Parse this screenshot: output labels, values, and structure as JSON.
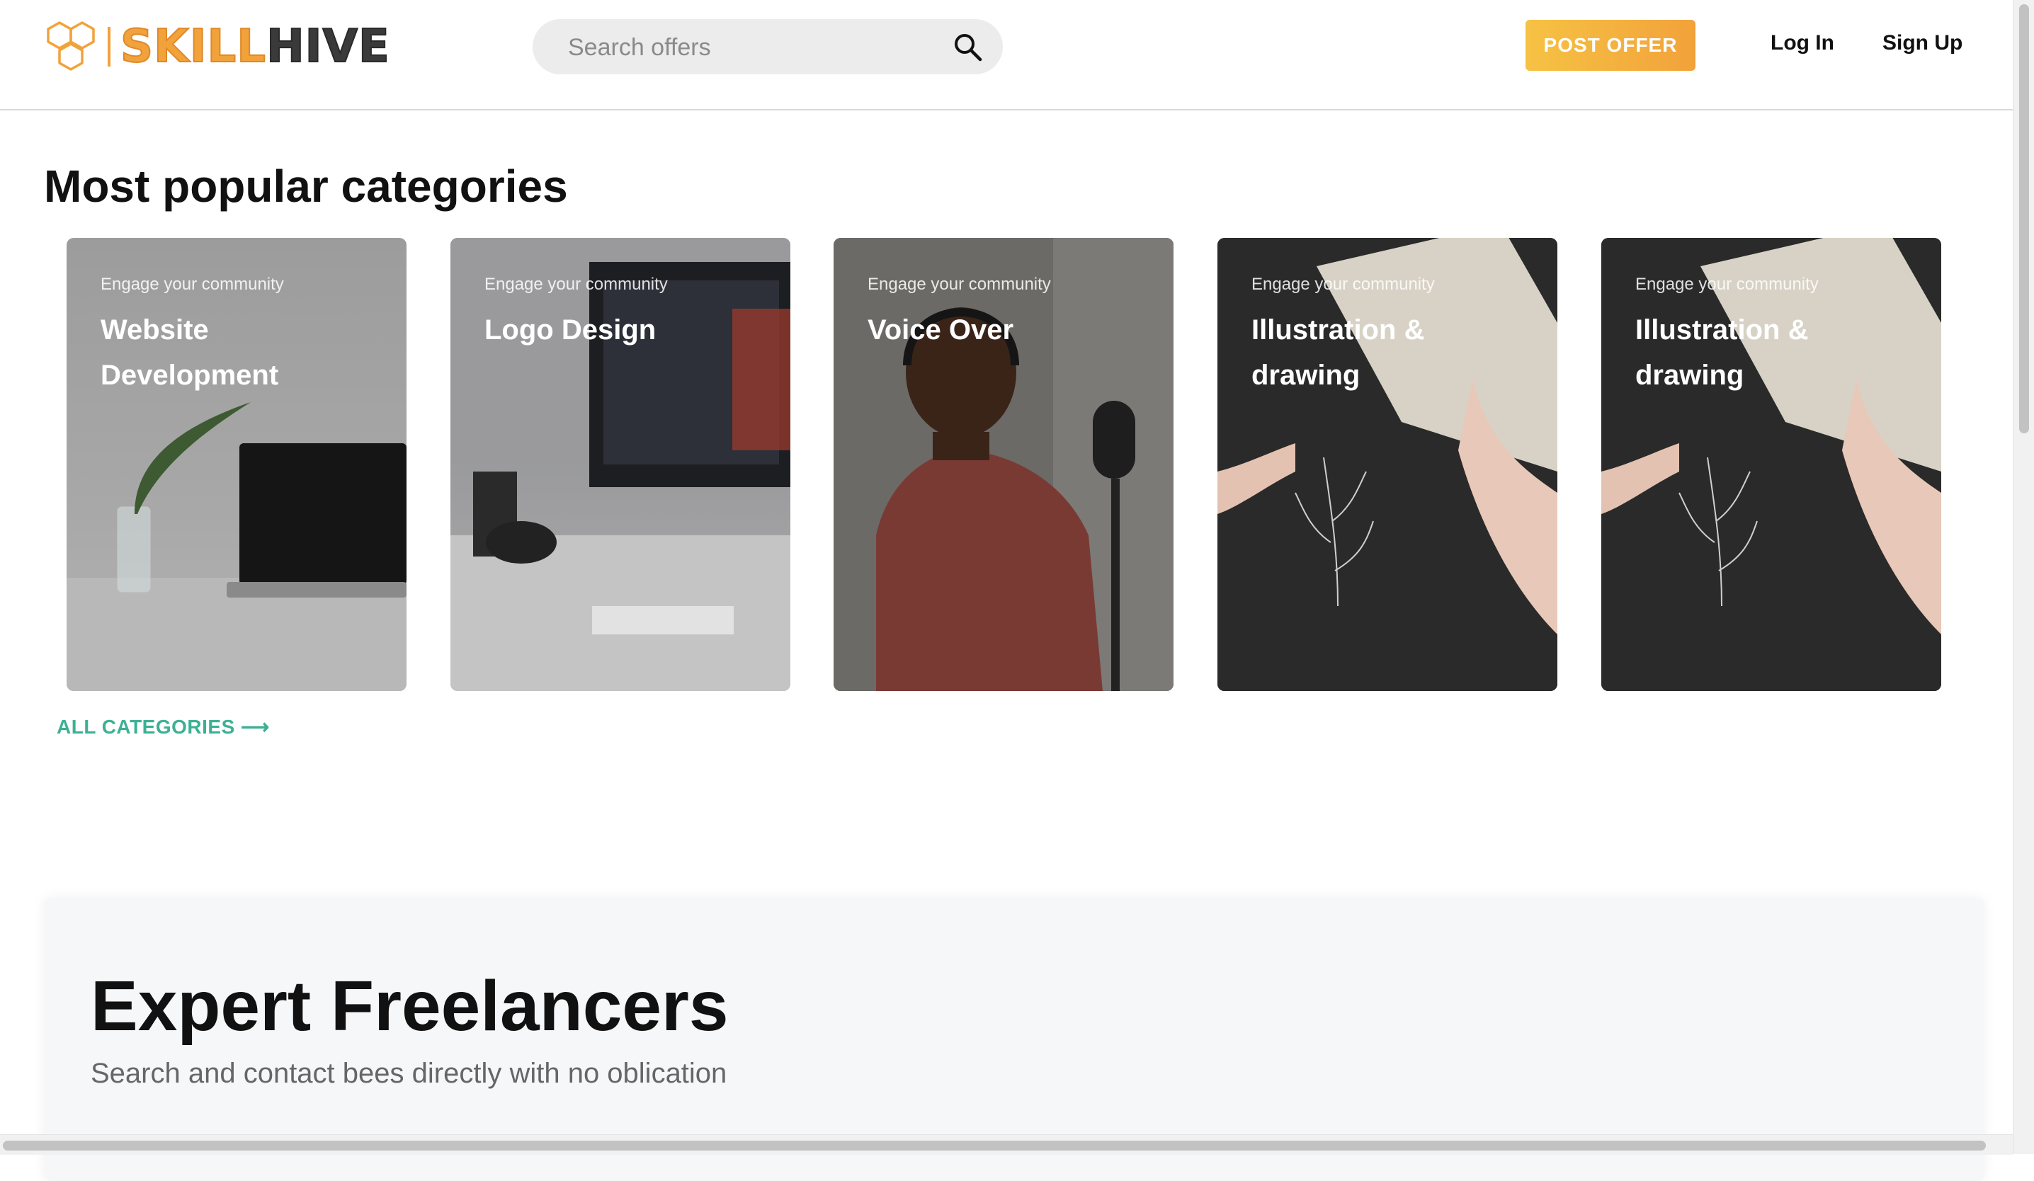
{
  "header": {
    "logo_text_1": "SKILL",
    "logo_text_2": "HIVE",
    "search_placeholder": "Search offers",
    "post_offer_label": "POST OFFER",
    "login_label": "Log In",
    "signup_label": "Sign Up"
  },
  "categories": {
    "title": "Most popular categories",
    "cards": [
      {
        "overline": "Engage your community",
        "title": "Website Development"
      },
      {
        "overline": "Engage your community",
        "title": "Logo Design"
      },
      {
        "overline": "Engage your community",
        "title": "Voice Over"
      },
      {
        "overline": "Engage your community",
        "title": "Illustration & drawing"
      },
      {
        "overline": "Engage your community",
        "title": "Illustration & drawing"
      }
    ],
    "all_link": "ALL CATEGORIES ⟶"
  },
  "experts": {
    "title": "Expert Freelancers",
    "subtitle": "Search and contact bees directly with no oblication"
  },
  "colors": {
    "brand_orange": "#f2a23a",
    "accent_green": "#3cb095",
    "dark": "#111111"
  },
  "icons": [
    "hexagon-logo-icon",
    "search-icon"
  ]
}
